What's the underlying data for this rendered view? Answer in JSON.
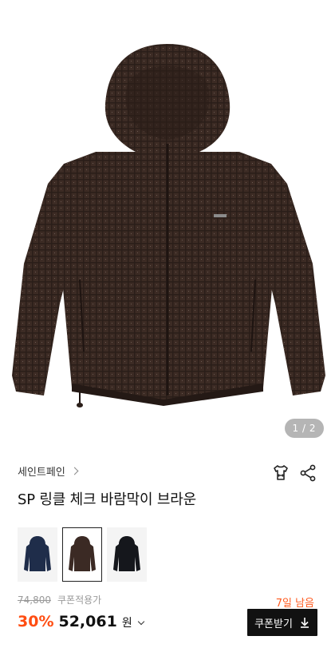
{
  "hero": {
    "pager": "1 / 2"
  },
  "brand": {
    "name": "세인트페인"
  },
  "product": {
    "title": "SP 링클 체크 바람막이 브라운"
  },
  "colors": {
    "options": [
      {
        "name": "navy",
        "swatch": "#1f2d4a"
      },
      {
        "name": "brown",
        "swatch": "#3b2a24"
      },
      {
        "name": "black",
        "swatch": "#15171c"
      }
    ],
    "selected_index": 1
  },
  "price": {
    "original": "74,800",
    "coupon_label": "쿠폰적용가",
    "discount": "30%",
    "final": "52,061",
    "currency": "원"
  },
  "coupon": {
    "days_left": "7일 남음",
    "button_label": "쿠폰받기"
  },
  "icons": {
    "size_guide": "shirt-size-icon",
    "share": "share-icon",
    "download": "download-icon"
  }
}
